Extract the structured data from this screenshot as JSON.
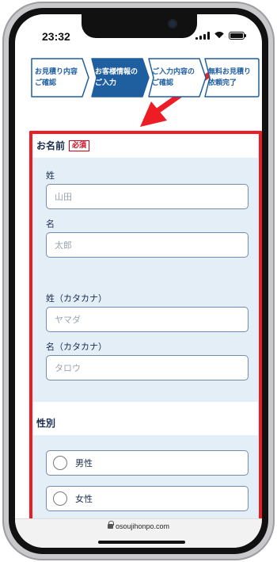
{
  "status_bar": {
    "time": "23:32",
    "icons": [
      "signal-icon",
      "wifi-icon",
      "battery-icon"
    ]
  },
  "steps": [
    {
      "label": "お見積り内容\nご確認",
      "active": false
    },
    {
      "label": "お客様情報の\nご入力",
      "active": true
    },
    {
      "label": "ご入力内容の\nご確認",
      "active": false
    },
    {
      "label": "無料お見積り\n依頼完了",
      "active": false
    }
  ],
  "form": {
    "name_section": {
      "title": "お名前",
      "required_badge": "必須"
    },
    "last_name": {
      "label": "姓",
      "placeholder": "山田"
    },
    "first_name": {
      "label": "名",
      "placeholder": "太郎"
    },
    "last_name_kana": {
      "label": "姓（カタカナ）",
      "placeholder": "ヤマダ"
    },
    "first_name_kana": {
      "label": "名（カタカナ）",
      "placeholder": "タロウ"
    },
    "gender_section": {
      "title": "性別"
    },
    "gender_options": [
      "男性",
      "女性"
    ]
  },
  "browser": {
    "url": "osoujihonpo.com"
  },
  "colors": {
    "highlight": "#ee1c25",
    "active_step": "#1f5fa0",
    "panel": "#e3eef7"
  }
}
